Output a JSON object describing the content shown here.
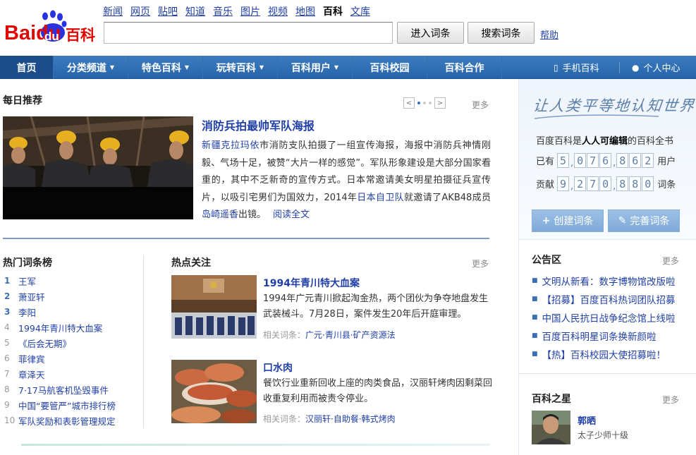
{
  "logo": {
    "brand_text": "Baidu",
    "product_text": "百科"
  },
  "topnav": {
    "items": [
      {
        "label": "新闻"
      },
      {
        "label": "网页"
      },
      {
        "label": "贴吧"
      },
      {
        "label": "知道"
      },
      {
        "label": "音乐"
      },
      {
        "label": "图片"
      },
      {
        "label": "视频"
      },
      {
        "label": "地图"
      },
      {
        "label": "百科",
        "current": true
      },
      {
        "label": "文库"
      }
    ]
  },
  "search": {
    "value": "",
    "enter_label": "进入词条",
    "search_label": "搜索词条",
    "help_label": "帮助"
  },
  "mainnav": {
    "items": [
      {
        "label": "首页",
        "active": true,
        "dropdown": false
      },
      {
        "label": "分类频道",
        "dropdown": true
      },
      {
        "label": "特色百科",
        "dropdown": true
      },
      {
        "label": "玩转百科",
        "dropdown": true
      },
      {
        "label": "百科用户",
        "dropdown": true
      },
      {
        "label": "百科校园",
        "dropdown": false
      },
      {
        "label": "百科合作",
        "dropdown": false
      }
    ],
    "mobile_label": "手机百科",
    "personal_label": "个人中心"
  },
  "daily": {
    "title": "每日推荐",
    "more": "更多",
    "headline": "消防兵拍最帅军队海报",
    "body_segments": [
      {
        "text": "新疆克拉玛依",
        "link": true
      },
      {
        "text": "市消防支队拍摄了一组宣传海报，海报中消防兵神情刚毅、气场十足，被赞“大片一样的感觉”。军队形象建设是大部分国家看重的，其中不乏新奇的宣传方式。日本常邀请美女明星拍摄征兵宣传片，以吸引宅男们为国效力，2014年",
        "link": false
      },
      {
        "text": "日本自卫队",
        "link": true
      },
      {
        "text": "就邀请了AKB48成员",
        "link": false
      },
      {
        "text": "岛崎遥香",
        "link": true
      },
      {
        "text": "出镜。",
        "link": false
      }
    ],
    "read_more": "阅读全文"
  },
  "hot_list": {
    "title": "热门词条榜",
    "items": [
      {
        "rank": "1",
        "name": "王军"
      },
      {
        "rank": "2",
        "name": "萧亚轩"
      },
      {
        "rank": "3",
        "name": "李阳"
      },
      {
        "rank": "4",
        "name": "1994年青川特大血案"
      },
      {
        "rank": "5",
        "name": "《后会无期》"
      },
      {
        "rank": "6",
        "name": "菲律宾"
      },
      {
        "rank": "7",
        "name": "章泽天"
      },
      {
        "rank": "8",
        "name": "7·17马航客机坠毁事件"
      },
      {
        "rank": "9",
        "name": "中国“要管严”城市排行榜"
      },
      {
        "rank": "10",
        "name": "军队奖励和表彰管理规定"
      }
    ]
  },
  "hotspot": {
    "title": "热点关注",
    "more": "更多",
    "items": [
      {
        "title": "1994年青川特大血案",
        "desc": "1994年广元青川掀起淘金热，两个团伙为争夺地盘发生武装械斗。7月28日，案件发生20年后开庭审理。",
        "related_label": "相关词条：",
        "related": "广元·青川县·矿产资源法"
      },
      {
        "title": "口水肉",
        "desc": "餐饮行业重新回收上座的肉类食品，汉丽轩烤肉因剩菜回收重复利用而被责令停业。",
        "related_label": "相关词条：",
        "related": "汉丽轩·自助餐·韩式烤肉"
      }
    ]
  },
  "right": {
    "slogan": "让人类平等地认知世界",
    "intro_prefix": "百度百科是",
    "intro_bold": "人人可编辑",
    "intro_suffix": "的百科全书",
    "users_label_pre": "已有",
    "users_label_post": "用户",
    "users_digits": [
      "5",
      "0",
      "7",
      "6",
      "8",
      "6",
      "2"
    ],
    "entries_label_pre": "贡献",
    "entries_label_post": "词条",
    "entries_digits": [
      "9",
      "2",
      "7",
      "0",
      "8",
      "8",
      "0"
    ],
    "create_label": "创建词条",
    "improve_label": "完善词条",
    "notice_title": "公告区",
    "notice_more": "更多",
    "notices": [
      "文明从新看：数字博物馆改版啦",
      "【招募】百度百科热词团队招募",
      "中国人民抗日战争纪念馆上线啦",
      "百度百科明星词条换新颜啦",
      "【热】百科校园大使招募啦！"
    ],
    "star_title": "百科之星",
    "star_more": "更多",
    "star_name": "郭晒",
    "star_level": "太子少师十级"
  }
}
